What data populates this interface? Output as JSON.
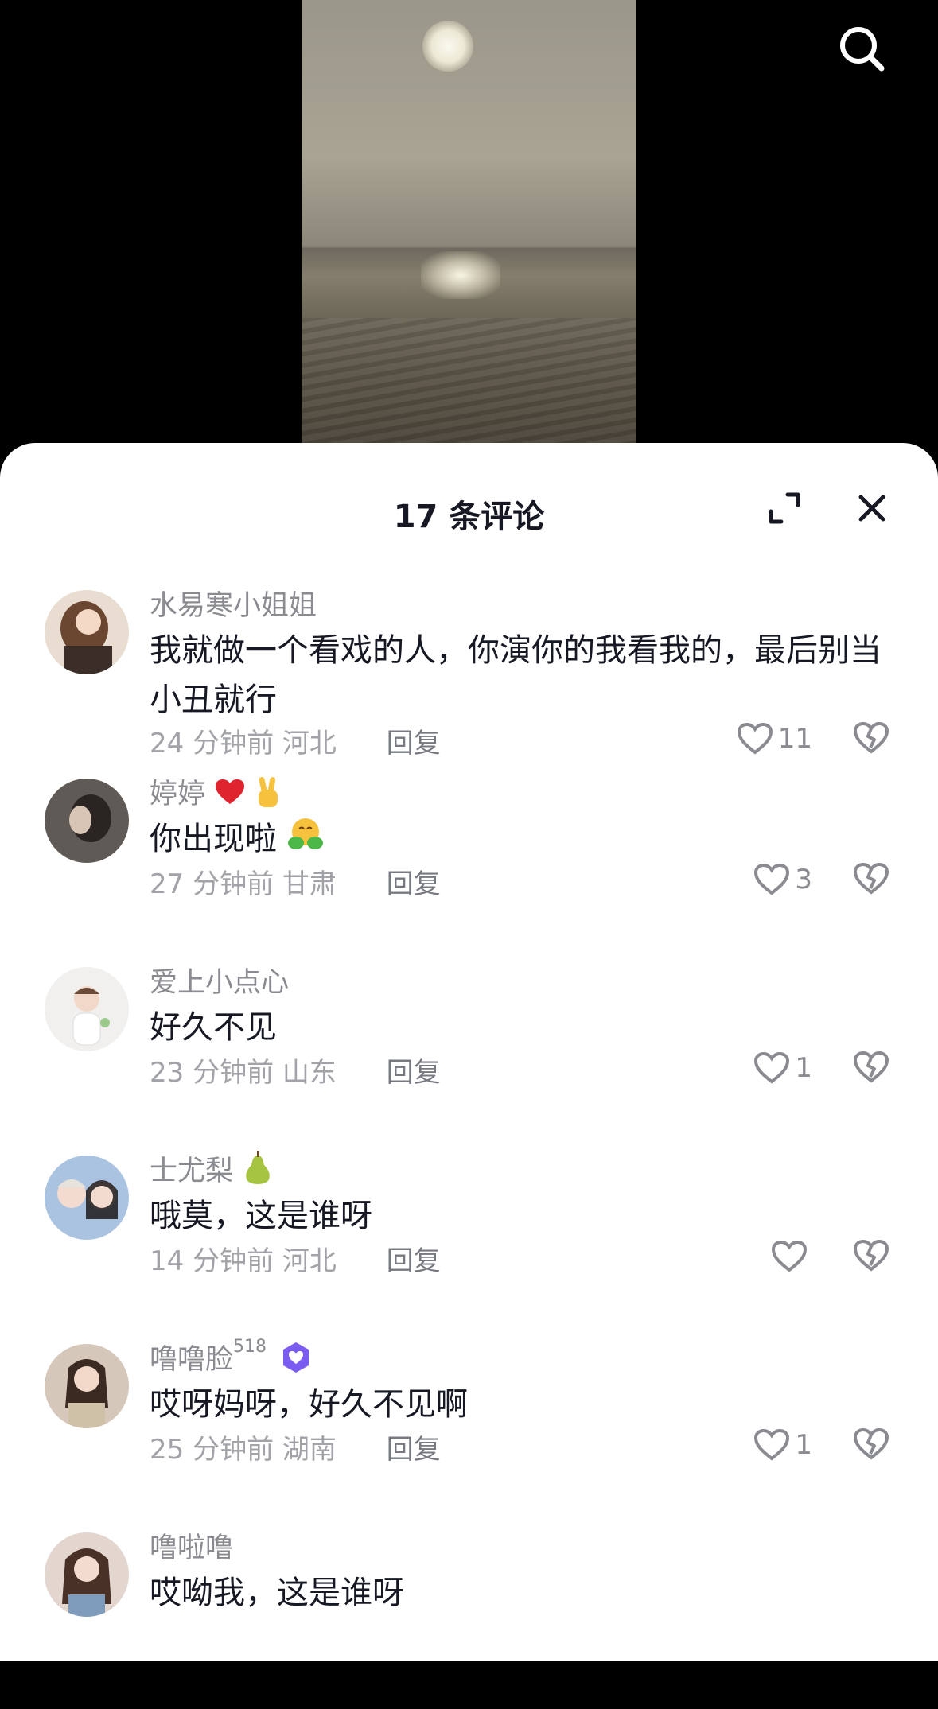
{
  "sheet": {
    "title": "17 条评论"
  },
  "comments": [
    {
      "user": "水易寒小姐姐",
      "text": "我就做一个看戏的人，你演你的我看我的，最后别当小丑就行",
      "time": "24 分钟前",
      "location": "河北",
      "reply": "回复",
      "likes": "11"
    },
    {
      "user": "婷婷",
      "text": "你出现啦",
      "time": "27 分钟前",
      "location": "甘肃",
      "reply": "回复",
      "likes": "3"
    },
    {
      "user": "爱上小点心",
      "text": "好久不见",
      "time": "23 分钟前",
      "location": "山东",
      "reply": "回复",
      "likes": "1"
    },
    {
      "user": "士尤梨",
      "text": "哦莫，这是谁呀",
      "time": "14 分钟前",
      "location": "河北",
      "reply": "回复",
      "likes": ""
    },
    {
      "user": "噜噜脸",
      "user_sup": "518",
      "text": "哎呀妈呀，好久不见啊",
      "time": "25 分钟前",
      "location": "湖南",
      "reply": "回复",
      "likes": "1"
    },
    {
      "user": "噜啦噜",
      "text": "哎呦我，这是谁呀",
      "time": "",
      "location": "",
      "reply": "",
      "likes": ""
    }
  ],
  "colors": {
    "accent": "#7b5cf0",
    "text": "#161823",
    "muted": "#a2a3a8"
  },
  "icons": [
    "search-icon",
    "expand-icon",
    "close-icon",
    "heart-icon",
    "broken-heart-icon"
  ]
}
